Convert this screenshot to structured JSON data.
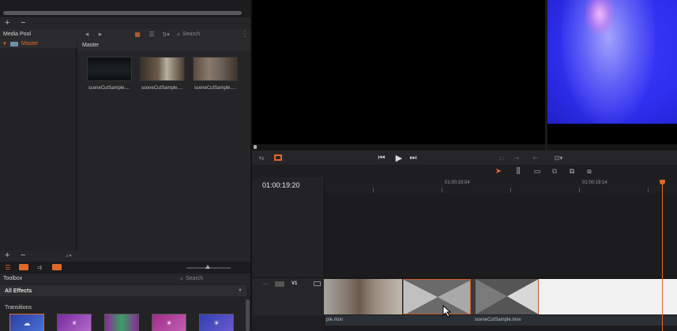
{
  "media_pool": {
    "title": "Media Pool",
    "add": "+",
    "remove": "−",
    "folder": "Master",
    "bin_title": "Master",
    "search_placeholder": "Search",
    "clips": [
      {
        "label": "sceneCutSample...."
      },
      {
        "label": "sceneCutSample...."
      },
      {
        "label": "sceneCutSample...."
      }
    ]
  },
  "toolbox": {
    "title": "Toolbox",
    "search_placeholder": "Search",
    "filter": "All Effects",
    "section": "Transitions"
  },
  "timeline": {
    "timecode": "01:00:19:20",
    "ruler": [
      "01:00:19:04",
      "01:00:19:14"
    ],
    "track": "V1",
    "clip_left_label": "ple.mov",
    "clip_right_label": "sceneCutSample.mov"
  },
  "colors": {
    "accent": "#e0692a",
    "viewer_blue": "#2f2ff0",
    "selection": "#c85a2a"
  }
}
